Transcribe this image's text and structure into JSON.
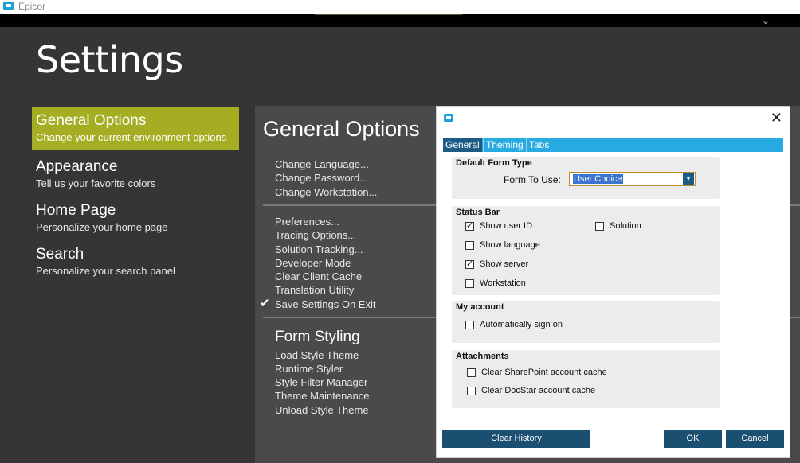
{
  "app": {
    "title": "Epicor"
  },
  "page": {
    "title": "Settings"
  },
  "nav": [
    {
      "title": "General Options",
      "subtitle": "Change your current environment options"
    },
    {
      "title": "Appearance",
      "subtitle": "Tell us your favorite colors"
    },
    {
      "title": "Home Page",
      "subtitle": "Personalize your home page"
    },
    {
      "title": "Search",
      "subtitle": "Personalize your search panel"
    }
  ],
  "panel": {
    "heading": "General Options",
    "group1": [
      "Change Language...",
      "Change Password...",
      "Change Workstation..."
    ],
    "group2": [
      "Preferences...",
      "Tracing Options...",
      "Solution Tracking...",
      "Developer Mode",
      "Clear Client Cache",
      "Translation Utility",
      "Save Settings On Exit"
    ],
    "form_styling": {
      "heading": "Form Styling",
      "items": [
        "Load Style Theme",
        "Runtime Styler",
        "Style Filter Manager",
        "Theme Maintenance",
        "Unload Style Theme"
      ]
    }
  },
  "dialog": {
    "tabs": [
      "General",
      "Theming",
      "Tabs"
    ],
    "default_form_type": {
      "title": "Default Form Type",
      "label": "Form To Use:",
      "value": "User Choice"
    },
    "status_bar": {
      "title": "Status Bar",
      "options": [
        {
          "label": "Show user ID",
          "checked": true
        },
        {
          "label": "Show language",
          "checked": false
        },
        {
          "label": "Show server",
          "checked": true
        },
        {
          "label": "Workstation",
          "checked": false
        },
        {
          "label": "Solution",
          "checked": false
        }
      ]
    },
    "my_account": {
      "title": "My account",
      "options": [
        {
          "label": "Automatically sign on",
          "checked": false
        }
      ]
    },
    "attachments": {
      "title": "Attachments",
      "options": [
        {
          "label": "Clear SharePoint account cache",
          "checked": false
        },
        {
          "label": "Clear DocStar account cache",
          "checked": false
        }
      ]
    },
    "buttons": {
      "clear_history": "Clear History",
      "ok": "OK",
      "cancel": "Cancel"
    }
  },
  "colors": {
    "accent": "#a5ae23",
    "tab_strip": "#26aae1",
    "button": "#1b4f72",
    "background": "#353535"
  }
}
